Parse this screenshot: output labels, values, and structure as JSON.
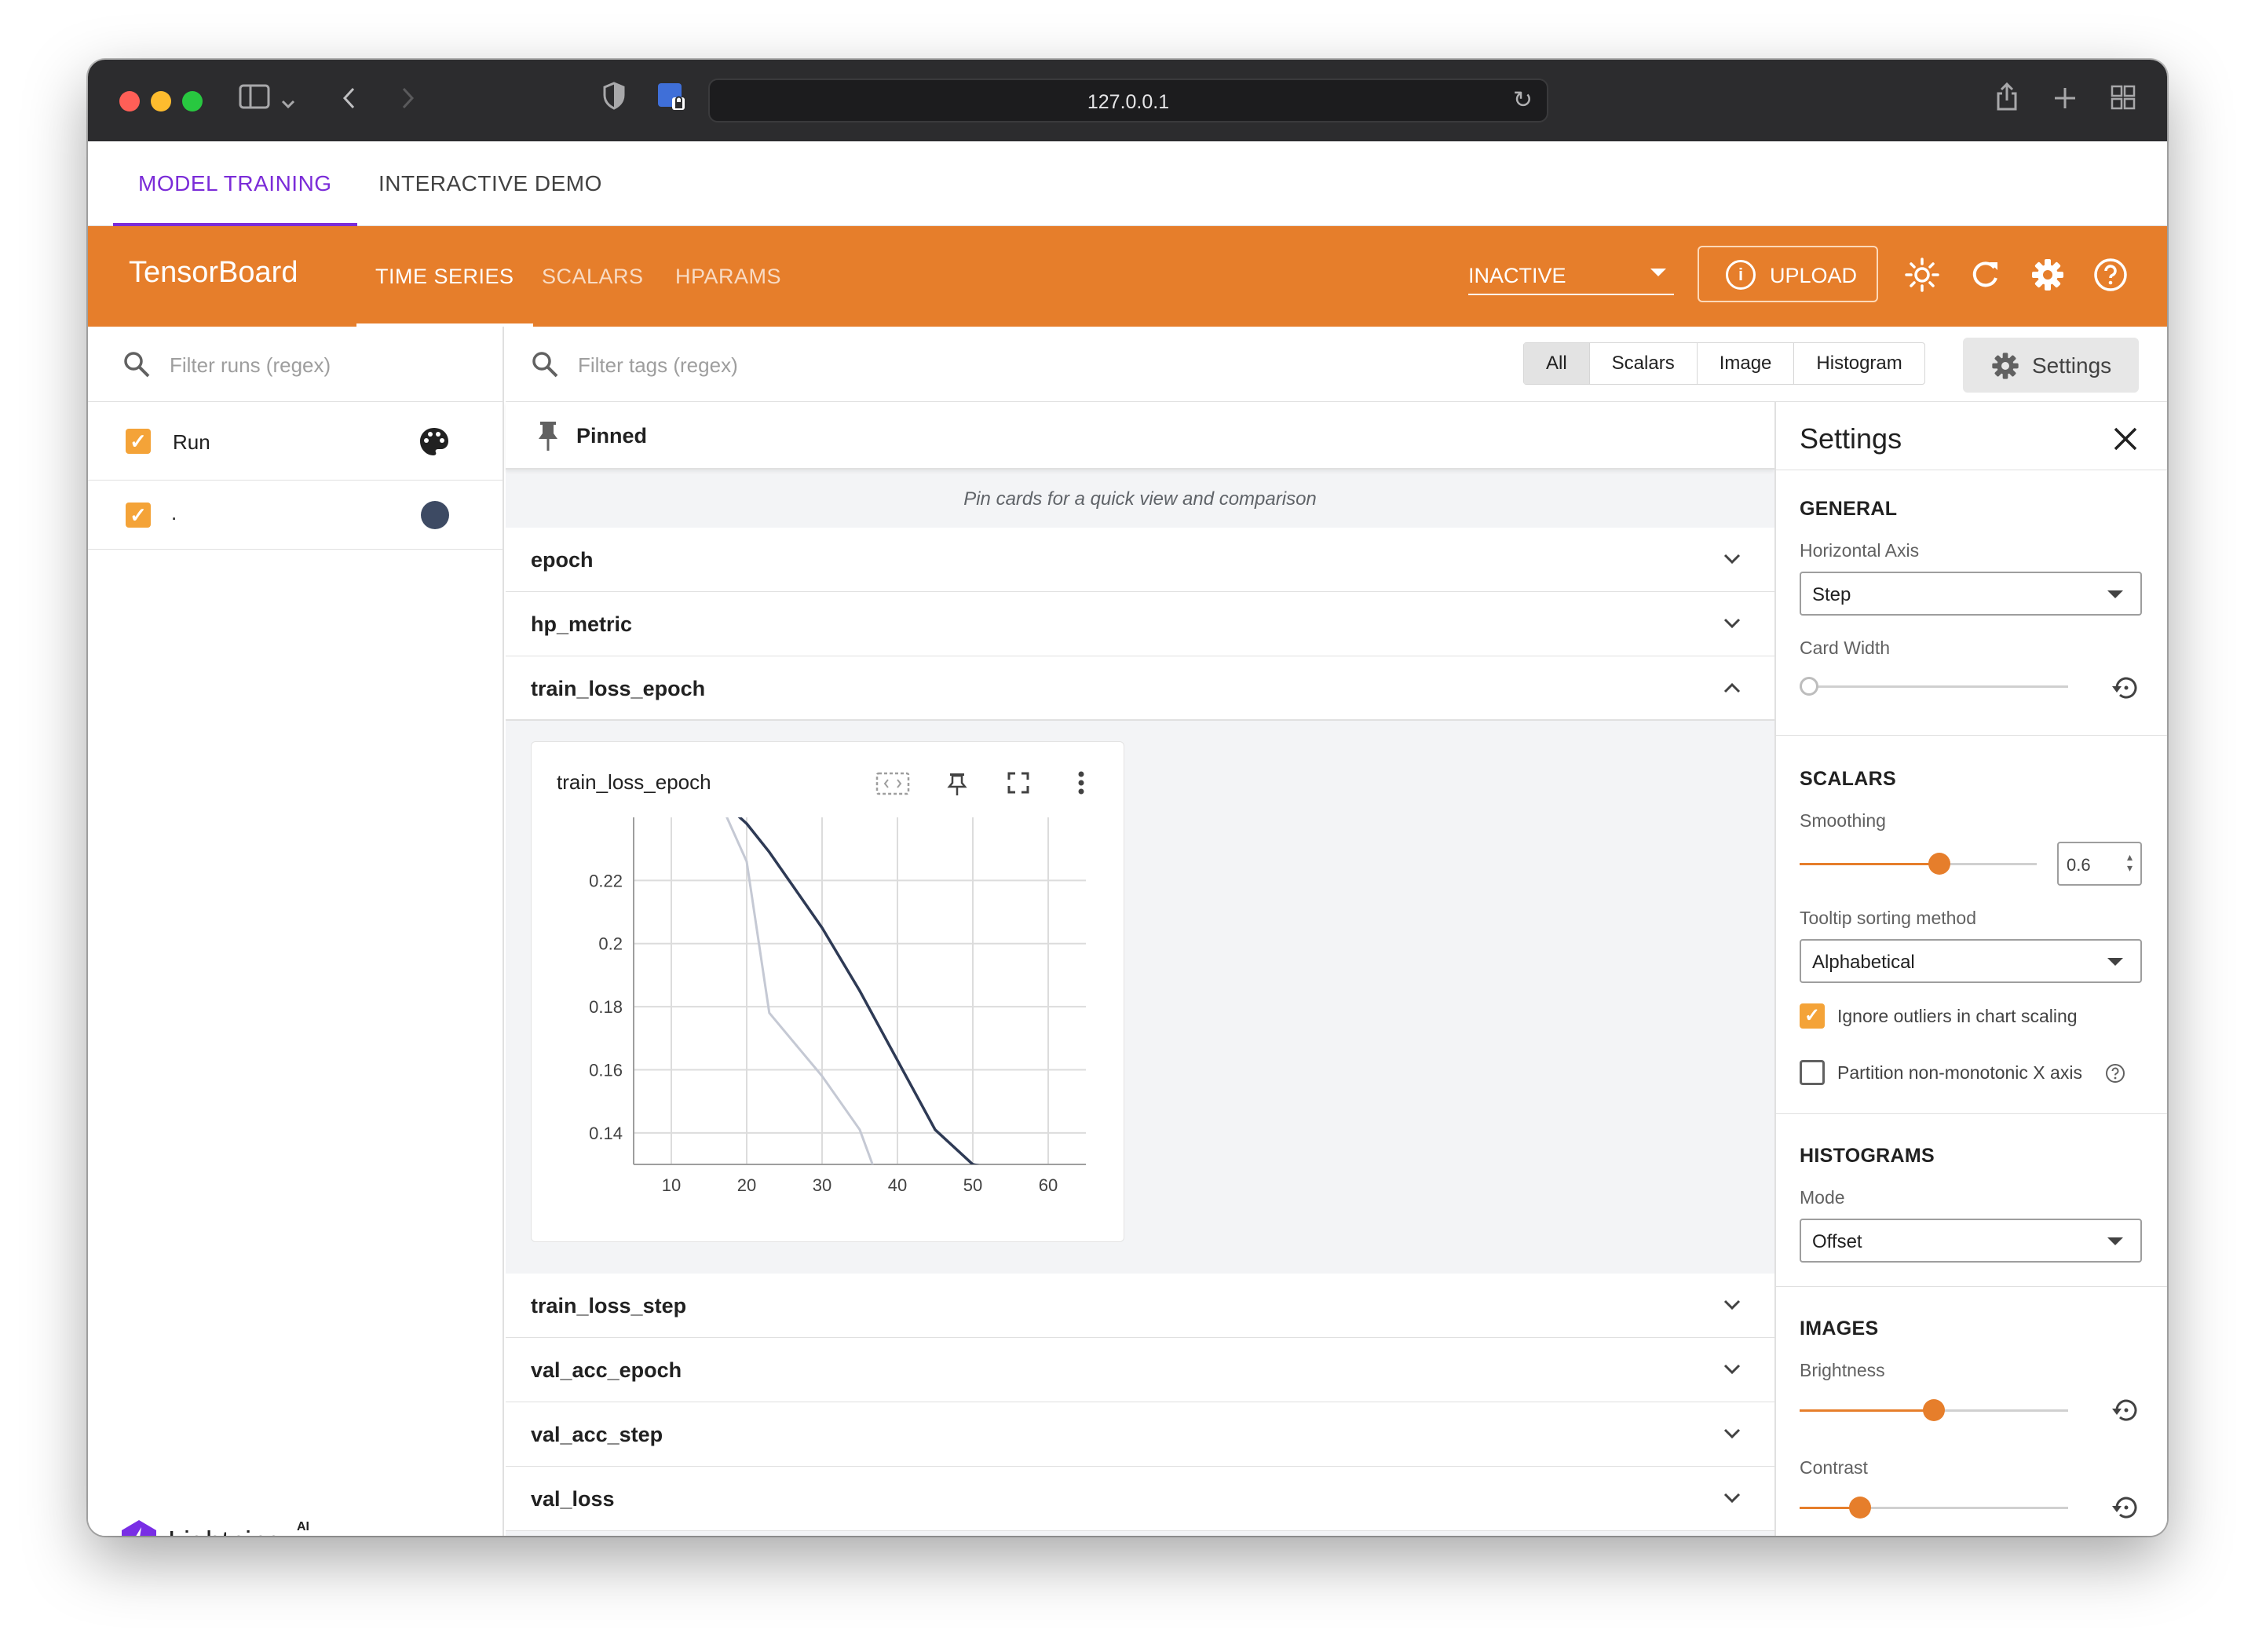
{
  "browser": {
    "url": "127.0.0.1"
  },
  "app_tabs": [
    {
      "label": "MODEL TRAINING",
      "active": true
    },
    {
      "label": "INTERACTIVE DEMO",
      "active": false
    }
  ],
  "toolbar": {
    "title": "TensorBoard",
    "tabs": [
      {
        "label": "TIME SERIES",
        "active": true
      },
      {
        "label": "SCALARS",
        "active": false
      },
      {
        "label": "HPARAMS",
        "active": false
      }
    ],
    "status_select": "INACTIVE",
    "upload_label": "UPLOAD",
    "accent": "#e67e2b"
  },
  "runs": {
    "filter_placeholder": "Filter runs (regex)",
    "items": [
      {
        "label": "Run",
        "checked": true,
        "icon": "palette-icon"
      },
      {
        "label": ".",
        "checked": true,
        "color": "#3d4a63"
      }
    ],
    "brand": "Lightning",
    "brand_suffix": "AI"
  },
  "main": {
    "filter_placeholder": "Filter tags (regex)",
    "type_filters": [
      "All",
      "Scalars",
      "Image",
      "Histogram"
    ],
    "selected_filter": "All",
    "settings_button": "Settings",
    "pinned_label": "Pinned",
    "pinned_note": "Pin cards for a quick view and comparison",
    "groups_top": [
      "epoch",
      "hp_metric",
      "train_loss_epoch"
    ],
    "groups_bottom": [
      "train_loss_step",
      "val_acc_epoch",
      "val_acc_step",
      "val_loss"
    ],
    "card_title": "train_loss_epoch"
  },
  "chart_data": {
    "type": "line",
    "title": "train_loss_epoch",
    "xlabel": "",
    "ylabel": "",
    "xlim": [
      5,
      65
    ],
    "ylim": [
      0.13,
      0.24
    ],
    "x_ticks": [
      10,
      20,
      30,
      40,
      50,
      60
    ],
    "y_ticks": [
      0.14,
      0.16,
      0.18,
      0.2,
      0.22
    ],
    "series": [
      {
        "style": "smoothed",
        "color": "#2e3a55",
        "x": [
          17,
          20,
          23,
          30,
          35,
          40,
          45,
          50,
          52
        ],
        "y": [
          0.2445,
          0.238,
          0.229,
          0.205,
          0.185,
          0.163,
          0.141,
          0.13,
          0.129
        ]
      },
      {
        "style": "raw",
        "color": "#c5c9d4",
        "x": [
          13,
          17,
          20,
          23,
          30,
          35,
          37,
          38
        ],
        "y": [
          0.2445,
          0.242,
          0.226,
          0.178,
          0.158,
          0.141,
          0.128,
          0.125
        ]
      }
    ],
    "grid": true
  },
  "settings": {
    "title": "Settings",
    "general": {
      "heading": "GENERAL",
      "horizontal_axis_label": "Horizontal Axis",
      "horizontal_axis_value": "Step",
      "card_width_label": "Card Width",
      "card_width_level": 0
    },
    "scalars": {
      "heading": "SCALARS",
      "smoothing_label": "Smoothing",
      "smoothing_value": "0.6",
      "smoothing_level": 0.6,
      "tooltip_label": "Tooltip sorting method",
      "tooltip_value": "Alphabetical",
      "ignore_outliers_label": "Ignore outliers in chart scaling",
      "ignore_outliers": true,
      "partition_label": "Partition non-monotonic X axis",
      "partition": false
    },
    "histograms": {
      "heading": "HISTOGRAMS",
      "mode_label": "Mode",
      "mode_value": "Offset"
    },
    "images": {
      "heading": "IMAGES",
      "brightness_label": "Brightness",
      "brightness_level": 0.5,
      "contrast_label": "Contrast",
      "contrast_level": 0.2
    }
  }
}
